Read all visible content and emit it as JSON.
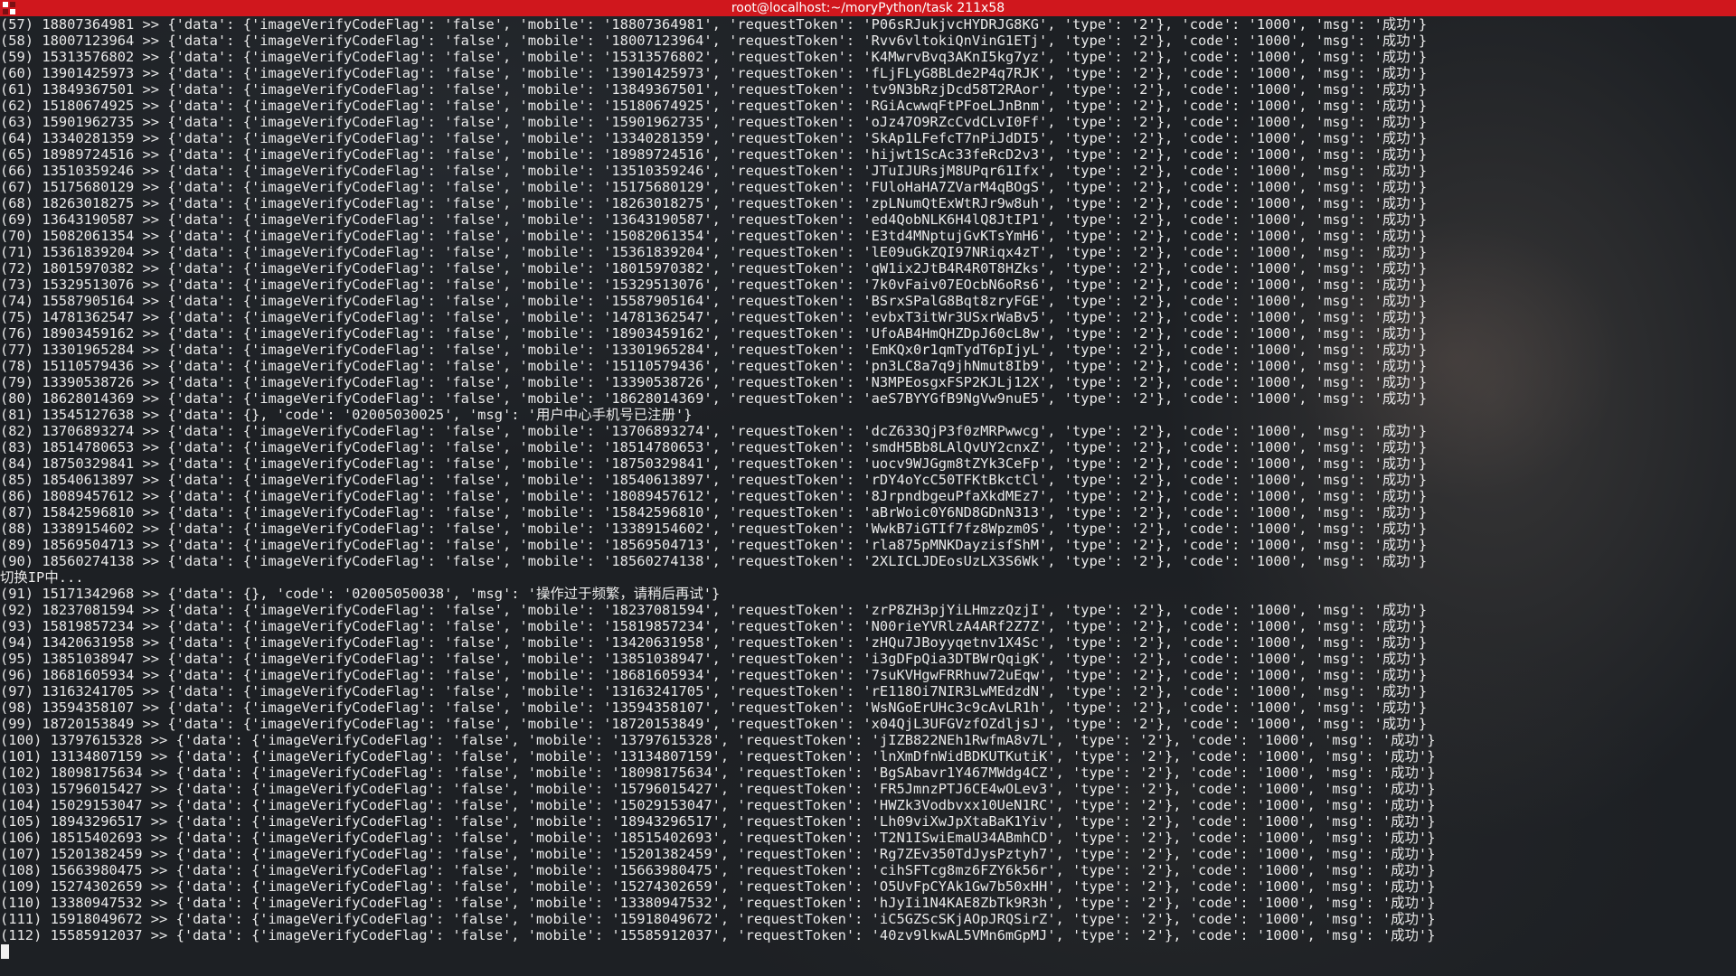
{
  "window": {
    "title": "root@localhost:~/moryPython/task 211x58"
  },
  "terminal": {
    "lines": [
      "(57) 18807364981 >> {'data': {'imageVerifyCodeFlag': 'false', 'mobile': '18807364981', 'requestToken': 'P06sRJukjvcHYDRJG8KG', 'type': '2'}, 'code': '1000', 'msg': '成功'}",
      "(58) 18007123964 >> {'data': {'imageVerifyCodeFlag': 'false', 'mobile': '18007123964', 'requestToken': 'Rvv6vltokiQnVinG1ETj', 'type': '2'}, 'code': '1000', 'msg': '成功'}",
      "(59) 15313576802 >> {'data': {'imageVerifyCodeFlag': 'false', 'mobile': '15313576802', 'requestToken': 'K4MwrvBvq3AKnI5kg7yz', 'type': '2'}, 'code': '1000', 'msg': '成功'}",
      "(60) 13901425973 >> {'data': {'imageVerifyCodeFlag': 'false', 'mobile': '13901425973', 'requestToken': 'fLjFLyG8BLde2P4q7RJK', 'type': '2'}, 'code': '1000', 'msg': '成功'}",
      "(61) 13849367501 >> {'data': {'imageVerifyCodeFlag': 'false', 'mobile': '13849367501', 'requestToken': 'tv9N3bRzjDcd58T2RAor', 'type': '2'}, 'code': '1000', 'msg': '成功'}",
      "(62) 15180674925 >> {'data': {'imageVerifyCodeFlag': 'false', 'mobile': '15180674925', 'requestToken': 'RGiAcwwqFtPFoeLJnBnm', 'type': '2'}, 'code': '1000', 'msg': '成功'}",
      "(63) 15901962735 >> {'data': {'imageVerifyCodeFlag': 'false', 'mobile': '15901962735', 'requestToken': 'oJz47O9RZcCvdCLvI0Ff', 'type': '2'}, 'code': '1000', 'msg': '成功'}",
      "(64) 13340281359 >> {'data': {'imageVerifyCodeFlag': 'false', 'mobile': '13340281359', 'requestToken': 'SkAp1LFefcT7nPiJdDI5', 'type': '2'}, 'code': '1000', 'msg': '成功'}",
      "(65) 18989724516 >> {'data': {'imageVerifyCodeFlag': 'false', 'mobile': '18989724516', 'requestToken': 'hijwt1ScAc33feRcD2v3', 'type': '2'}, 'code': '1000', 'msg': '成功'}",
      "(66) 13510359246 >> {'data': {'imageVerifyCodeFlag': 'false', 'mobile': '13510359246', 'requestToken': 'JTuIJURsjM8UPqr61Ifx', 'type': '2'}, 'code': '1000', 'msg': '成功'}",
      "(67) 15175680129 >> {'data': {'imageVerifyCodeFlag': 'false', 'mobile': '15175680129', 'requestToken': 'FUloHaHA7ZVarM4qBOgS', 'type': '2'}, 'code': '1000', 'msg': '成功'}",
      "(68) 18263018275 >> {'data': {'imageVerifyCodeFlag': 'false', 'mobile': '18263018275', 'requestToken': 'zpLNumQtExWtRJr9w8uh', 'type': '2'}, 'code': '1000', 'msg': '成功'}",
      "(69) 13643190587 >> {'data': {'imageVerifyCodeFlag': 'false', 'mobile': '13643190587', 'requestToken': 'ed4QobNLK6H4lQ8JtIP1', 'type': '2'}, 'code': '1000', 'msg': '成功'}",
      "(70) 15082061354 >> {'data': {'imageVerifyCodeFlag': 'false', 'mobile': '15082061354', 'requestToken': 'E3td4MNptujGvKTsYmH6', 'type': '2'}, 'code': '1000', 'msg': '成功'}",
      "(71) 15361839204 >> {'data': {'imageVerifyCodeFlag': 'false', 'mobile': '15361839204', 'requestToken': 'lE09uGkZQI97NRiqx4zT', 'type': '2'}, 'code': '1000', 'msg': '成功'}",
      "(72) 18015970382 >> {'data': {'imageVerifyCodeFlag': 'false', 'mobile': '18015970382', 'requestToken': 'qW1ix2JtB4R4R0T8HZks', 'type': '2'}, 'code': '1000', 'msg': '成功'}",
      "(73) 15329513076 >> {'data': {'imageVerifyCodeFlag': 'false', 'mobile': '15329513076', 'requestToken': '7k0vFaiv07EOcbN6oRs6', 'type': '2'}, 'code': '1000', 'msg': '成功'}",
      "(74) 15587905164 >> {'data': {'imageVerifyCodeFlag': 'false', 'mobile': '15587905164', 'requestToken': 'BSrxSPalG8Bqt8zryFGE', 'type': '2'}, 'code': '1000', 'msg': '成功'}",
      "(75) 14781362547 >> {'data': {'imageVerifyCodeFlag': 'false', 'mobile': '14781362547', 'requestToken': 'evbxT3itWr3USxrWaBv5', 'type': '2'}, 'code': '1000', 'msg': '成功'}",
      "(76) 18903459162 >> {'data': {'imageVerifyCodeFlag': 'false', 'mobile': '18903459162', 'requestToken': 'UfoAB4HmQHZDpJ60cL8w', 'type': '2'}, 'code': '1000', 'msg': '成功'}",
      "(77) 13301965284 >> {'data': {'imageVerifyCodeFlag': 'false', 'mobile': '13301965284', 'requestToken': 'EmKQx0r1qmTydT6pIjyL', 'type': '2'}, 'code': '1000', 'msg': '成功'}",
      "(78) 15110579436 >> {'data': {'imageVerifyCodeFlag': 'false', 'mobile': '15110579436', 'requestToken': 'pn3LC8a7q9jhNmut8Ib9', 'type': '2'}, 'code': '1000', 'msg': '成功'}",
      "(79) 13390538726 >> {'data': {'imageVerifyCodeFlag': 'false', 'mobile': '13390538726', 'requestToken': 'N3MPEosgxFSP2KJLj12X', 'type': '2'}, 'code': '1000', 'msg': '成功'}",
      "(80) 18628014369 >> {'data': {'imageVerifyCodeFlag': 'false', 'mobile': '18628014369', 'requestToken': 'aeS7BYYGfB9NgVw9nuE5', 'type': '2'}, 'code': '1000', 'msg': '成功'}",
      "(81) 13545127638 >> {'data': {}, 'code': '02005030025', 'msg': '用户中心手机号已注册'}",
      "(82) 13706893274 >> {'data': {'imageVerifyCodeFlag': 'false', 'mobile': '13706893274', 'requestToken': 'dcZ633QjP3f0zMRPwwcg', 'type': '2'}, 'code': '1000', 'msg': '成功'}",
      "(83) 18514780653 >> {'data': {'imageVerifyCodeFlag': 'false', 'mobile': '18514780653', 'requestToken': 'smdH5Bb8LAlQvUY2cnxZ', 'type': '2'}, 'code': '1000', 'msg': '成功'}",
      "(84) 18750329841 >> {'data': {'imageVerifyCodeFlag': 'false', 'mobile': '18750329841', 'requestToken': 'uocv9WJGgm8tZYk3CeFp', 'type': '2'}, 'code': '1000', 'msg': '成功'}",
      "(85) 18540613897 >> {'data': {'imageVerifyCodeFlag': 'false', 'mobile': '18540613897', 'requestToken': 'rDY4oYcC50TFKtBkctCl', 'type': '2'}, 'code': '1000', 'msg': '成功'}",
      "(86) 18089457612 >> {'data': {'imageVerifyCodeFlag': 'false', 'mobile': '18089457612', 'requestToken': '8JrpndbgeuPfaXkdMEz7', 'type': '2'}, 'code': '1000', 'msg': '成功'}",
      "(87) 15842596810 >> {'data': {'imageVerifyCodeFlag': 'false', 'mobile': '15842596810', 'requestToken': 'aBrWoic0Y6ND8GDnN313', 'type': '2'}, 'code': '1000', 'msg': '成功'}",
      "(88) 13389154602 >> {'data': {'imageVerifyCodeFlag': 'false', 'mobile': '13389154602', 'requestToken': 'WwkB7iGTIf7fz8Wpzm0S', 'type': '2'}, 'code': '1000', 'msg': '成功'}",
      "(89) 18569504713 >> {'data': {'imageVerifyCodeFlag': 'false', 'mobile': '18569504713', 'requestToken': 'rla875pMNKDayzisfShM', 'type': '2'}, 'code': '1000', 'msg': '成功'}",
      "(90) 18560274138 >> {'data': {'imageVerifyCodeFlag': 'false', 'mobile': '18560274138', 'requestToken': '2XLICLJDEosUzLX3S6Wk', 'type': '2'}, 'code': '1000', 'msg': '成功'}",
      "切换IP中...",
      "(91) 15171342968 >> {'data': {}, 'code': '02005050038', 'msg': '操作过于频繁，请稍后再试'}",
      "(92) 18237081594 >> {'data': {'imageVerifyCodeFlag': 'false', 'mobile': '18237081594', 'requestToken': 'zrP8ZH3pjYiLHmzzQzjI', 'type': '2'}, 'code': '1000', 'msg': '成功'}",
      "(93) 15819857234 >> {'data': {'imageVerifyCodeFlag': 'false', 'mobile': '15819857234', 'requestToken': 'N00rieYVRlzA4ARf2Z7Z', 'type': '2'}, 'code': '1000', 'msg': '成功'}",
      "(94) 13420631958 >> {'data': {'imageVerifyCodeFlag': 'false', 'mobile': '13420631958', 'requestToken': 'zHQu7JBoyyqetnv1X4Sc', 'type': '2'}, 'code': '1000', 'msg': '成功'}",
      "(95) 13851038947 >> {'data': {'imageVerifyCodeFlag': 'false', 'mobile': '13851038947', 'requestToken': 'i3gDFpQia3DTBWrQqigK', 'type': '2'}, 'code': '1000', 'msg': '成功'}",
      "(96) 18681605934 >> {'data': {'imageVerifyCodeFlag': 'false', 'mobile': '18681605934', 'requestToken': '7suKVHgwFRRhuw72uEqw', 'type': '2'}, 'code': '1000', 'msg': '成功'}",
      "(97) 13163241705 >> {'data': {'imageVerifyCodeFlag': 'false', 'mobile': '13163241705', 'requestToken': 'rE118Oi7NIR3LwMEdzdN', 'type': '2'}, 'code': '1000', 'msg': '成功'}",
      "(98) 13594358107 >> {'data': {'imageVerifyCodeFlag': 'false', 'mobile': '13594358107', 'requestToken': 'WsNGoErUHc3c9cAvLR1h', 'type': '2'}, 'code': '1000', 'msg': '成功'}",
      "(99) 18720153849 >> {'data': {'imageVerifyCodeFlag': 'false', 'mobile': '18720153849', 'requestToken': 'x04QjL3UFGVzfOZdljsJ', 'type': '2'}, 'code': '1000', 'msg': '成功'}",
      "(100) 13797615328 >> {'data': {'imageVerifyCodeFlag': 'false', 'mobile': '13797615328', 'requestToken': 'jIZB822NEh1RwfmA8v7L', 'type': '2'}, 'code': '1000', 'msg': '成功'}",
      "(101) 13134807159 >> {'data': {'imageVerifyCodeFlag': 'false', 'mobile': '13134807159', 'requestToken': 'lnXmDfnWidBDKUTKutiK', 'type': '2'}, 'code': '1000', 'msg': '成功'}",
      "(102) 18098175634 >> {'data': {'imageVerifyCodeFlag': 'false', 'mobile': '18098175634', 'requestToken': 'BgSAbavr1Y467MWdg4CZ', 'type': '2'}, 'code': '1000', 'msg': '成功'}",
      "(103) 15796015427 >> {'data': {'imageVerifyCodeFlag': 'false', 'mobile': '15796015427', 'requestToken': 'FR5JmnzPTJ6CE4wOLev3', 'type': '2'}, 'code': '1000', 'msg': '成功'}",
      "(104) 15029153047 >> {'data': {'imageVerifyCodeFlag': 'false', 'mobile': '15029153047', 'requestToken': 'HWZk3Vodbvxx10UeN1RC', 'type': '2'}, 'code': '1000', 'msg': '成功'}",
      "(105) 18943296517 >> {'data': {'imageVerifyCodeFlag': 'false', 'mobile': '18943296517', 'requestToken': 'Lh09viXwJpXtaBaK1Yiv', 'type': '2'}, 'code': '1000', 'msg': '成功'}",
      "(106) 18515402693 >> {'data': {'imageVerifyCodeFlag': 'false', 'mobile': '18515402693', 'requestToken': 'T2N1ISwiEmaU34ABmhCD', 'type': '2'}, 'code': '1000', 'msg': '成功'}",
      "(107) 15201382459 >> {'data': {'imageVerifyCodeFlag': 'false', 'mobile': '15201382459', 'requestToken': 'Rg7ZEv350TdJysPztyh7', 'type': '2'}, 'code': '1000', 'msg': '成功'}",
      "(108) 15663980475 >> {'data': {'imageVerifyCodeFlag': 'false', 'mobile': '15663980475', 'requestToken': 'cihSFTcg8mz6FZY6k56r', 'type': '2'}, 'code': '1000', 'msg': '成功'}",
      "(109) 15274302659 >> {'data': {'imageVerifyCodeFlag': 'false', 'mobile': '15274302659', 'requestToken': 'O5UvFpCYAk1Gw7b50xHH', 'type': '2'}, 'code': '1000', 'msg': '成功'}",
      "(110) 13380947532 >> {'data': {'imageVerifyCodeFlag': 'false', 'mobile': '13380947532', 'requestToken': 'hJyIi1N4KAE8ZbTk9R3h', 'type': '2'}, 'code': '1000', 'msg': '成功'}",
      "(111) 15918049672 >> {'data': {'imageVerifyCodeFlag': 'false', 'mobile': '15918049672', 'requestToken': 'iC5GZScSKjAOpJRQSirZ', 'type': '2'}, 'code': '1000', 'msg': '成功'}",
      "(112) 15585912037 >> {'data': {'imageVerifyCodeFlag': 'false', 'mobile': '15585912037', 'requestToken': '40zv9lkwAL5VMn6mGpMJ', 'type': '2'}, 'code': '1000', 'msg': '成功'}"
    ]
  },
  "colors": {
    "titlebar_bg": "#d0171d",
    "terminal_text": "#e9e9e9"
  }
}
